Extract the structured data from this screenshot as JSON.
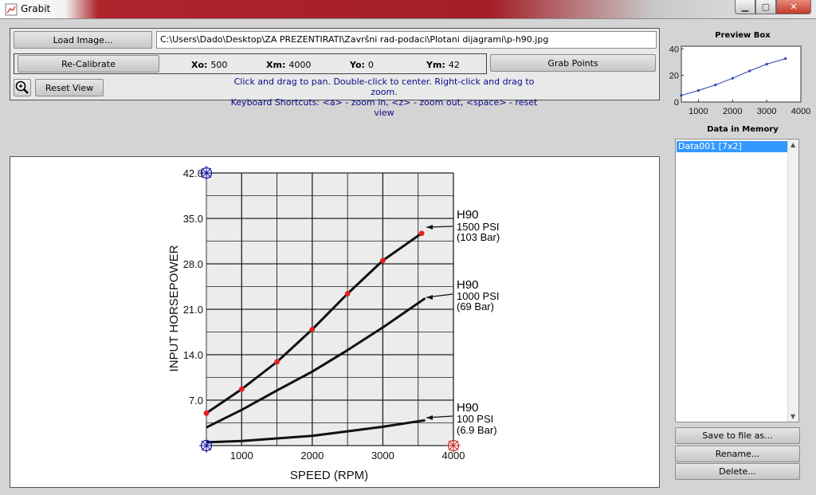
{
  "window": {
    "title": "Grabit"
  },
  "toolbar": {
    "load_label": "Load Image...",
    "path": "C:\\Users\\Dado\\Desktop\\ZA PREZENTIRATI\\Završni rad-podaci\\Plotani dijagrami\\p-h90.jpg",
    "recalibrate_label": "Re-Calibrate",
    "grab_label": "Grab Points",
    "reset_label": "Reset View",
    "calibration": {
      "xo_label": "Xo:",
      "xo": "500",
      "xm_label": "Xm:",
      "xm": "4000",
      "yo_label": "Yo:",
      "yo": "0",
      "ym_label": "Ym:",
      "ym": "42"
    },
    "hint_line1": "Click and drag to pan. Double-click to center. Right-click and drag to zoom.",
    "hint_line2": "Keyboard Shortcuts: <a> - zoom in, <z> - zoom out, <space> - reset view"
  },
  "image": {
    "ylabel": "INPUT HORSEPOWER",
    "xlabel": "SPEED (RPM)",
    "yticks": [
      "42.0",
      "35.0",
      "28.0",
      "21.0",
      "14.0",
      "7.0"
    ],
    "xticks": [
      "1000",
      "2000",
      "3000",
      "4000"
    ],
    "curves": [
      {
        "l1": "H90",
        "l2": "1500 PSI",
        "l3": "(103 Bar)"
      },
      {
        "l1": "H90",
        "l2": "1000 PSI",
        "l3": "(69 Bar)"
      },
      {
        "l1": "H90",
        "l2": "100 PSI",
        "l3": "(6.9 Bar)"
      }
    ],
    "grabbed_points": [
      {
        "x": 500,
        "y": 5.0
      },
      {
        "x": 1000,
        "y": 8.7
      },
      {
        "x": 1500,
        "y": 12.9
      },
      {
        "x": 2000,
        "y": 17.9
      },
      {
        "x": 2500,
        "y": 23.4
      },
      {
        "x": 3000,
        "y": 28.5
      },
      {
        "x": 3550,
        "y": 32.7
      }
    ],
    "colors": {
      "point": "#e52020",
      "calib": "#1a1aa0",
      "grid_bg": "#ececec"
    }
  },
  "preview": {
    "title": "Preview Box",
    "yticks": [
      "40",
      "20",
      "0"
    ],
    "xticks": [
      "1000",
      "2000",
      "3000",
      "4000"
    ]
  },
  "memory": {
    "title": "Data in Memory",
    "items": [
      "Data001 [7x2]"
    ]
  },
  "actions": {
    "save_label": "Save to file as...",
    "rename_label": "Rename...",
    "delete_label": "Delete..."
  },
  "chart_data": {
    "type": "line",
    "xlabel": "SPEED (RPM)",
    "ylabel": "INPUT HORSEPOWER",
    "xlim": [
      500,
      4000
    ],
    "ylim": [
      0,
      42
    ],
    "series": [
      {
        "name": "H90 1500 PSI (103 Bar)",
        "x": [
          500,
          1000,
          1500,
          2000,
          2500,
          3000,
          3550
        ],
        "values": [
          5.0,
          8.7,
          12.9,
          17.9,
          23.4,
          28.5,
          32.7
        ]
      },
      {
        "name": "H90 1000 PSI (69 Bar)",
        "x": [
          500,
          1000,
          1500,
          2000,
          2500,
          3000,
          3600
        ],
        "values": [
          2.8,
          5.5,
          8.5,
          11.4,
          14.7,
          18.2,
          22.7
        ]
      },
      {
        "name": "H90 100 PSI (6.9 Bar)",
        "x": [
          500,
          1000,
          1500,
          2000,
          2500,
          3000,
          3600
        ],
        "values": [
          0.5,
          0.7,
          1.1,
          1.5,
          2.2,
          2.9,
          3.9
        ]
      }
    ],
    "grid": true
  }
}
